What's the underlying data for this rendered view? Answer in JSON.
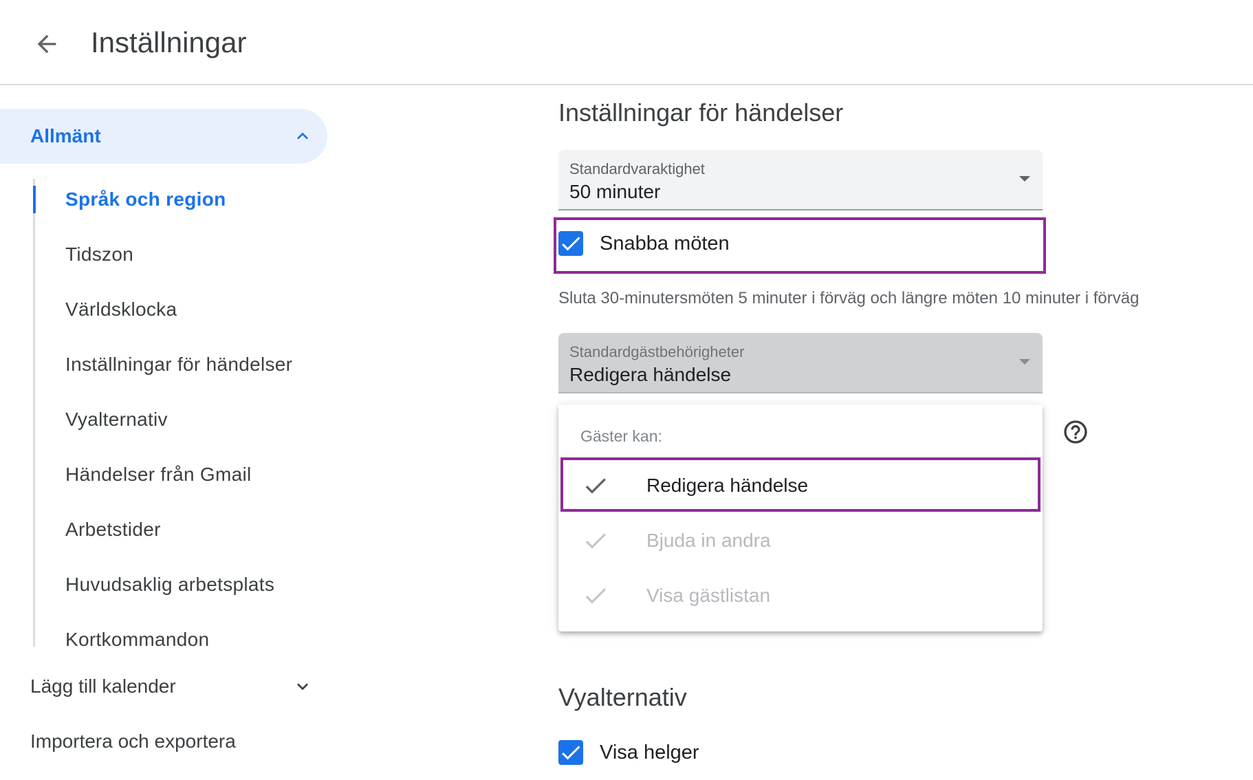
{
  "header": {
    "back_icon": "arrow-left-icon",
    "title": "Inställningar"
  },
  "sidebar": {
    "group": {
      "label": "Allmänt",
      "icon": "chevron-up-icon",
      "expanded": true
    },
    "sub_items": [
      {
        "label": "Språk och region",
        "active": true
      },
      {
        "label": "Tidszon"
      },
      {
        "label": "Världsklocka"
      },
      {
        "label": "Inställningar för händelser"
      },
      {
        "label": "Vyalternativ"
      },
      {
        "label": "Händelser från Gmail"
      },
      {
        "label": "Arbetstider"
      },
      {
        "label": "Huvudsaklig arbetsplats"
      },
      {
        "label": "Kortkommandon"
      }
    ],
    "add_calendar": {
      "label": "Lägg till kalender",
      "icon": "chevron-down-icon"
    },
    "import_export": {
      "label": "Importera och exportera"
    }
  },
  "event_settings": {
    "title": "Inställningar för händelser",
    "default_duration": {
      "label": "Standardvaraktighet",
      "value": "50 minuter"
    },
    "speedy_meetings": {
      "label": "Snabba möten",
      "checked": true
    },
    "speedy_help": "Sluta 30-minutersmöten 5 minuter i förväg och längre möten 10 minuter i förväg",
    "guest_permissions": {
      "label": "Standardgästbehörigheter",
      "value": "Redigera händelse"
    },
    "help_icon": "help-circle-icon",
    "menu": {
      "header": "Gäster kan:",
      "items": [
        {
          "label": "Redigera händelse",
          "enabled": true
        },
        {
          "label": "Bjuda in andra",
          "enabled": false
        },
        {
          "label": "Visa gästlistan",
          "enabled": false
        }
      ]
    }
  },
  "view_options": {
    "title": "Vyalternativ",
    "show_weekends": {
      "label": "Visa helger",
      "checked": true
    }
  },
  "colors": {
    "accent": "#1a73e8",
    "highlight": "#8e2c96",
    "selected_nav_bg": "#e8f0fe"
  }
}
